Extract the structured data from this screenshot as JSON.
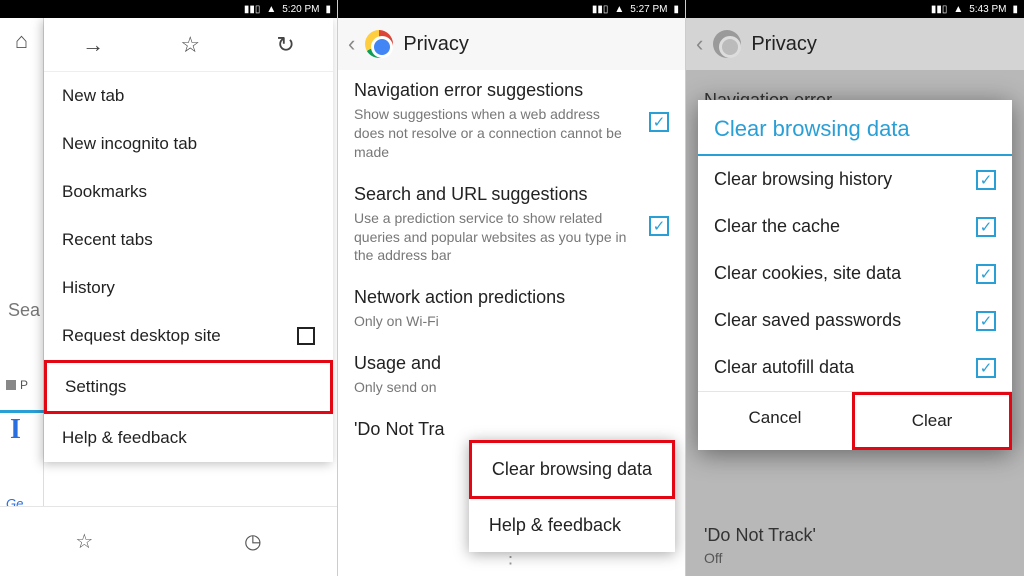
{
  "status": {
    "time1": "5:20 PM",
    "time2": "5:27 PM",
    "time3": "5:43 PM"
  },
  "panel1": {
    "search_partial": "Sea",
    "tab_label_partial": "P",
    "big_letter": "I",
    "get_partial": "Ge",
    "menu": {
      "new_tab": "New tab",
      "new_incognito": "New incognito tab",
      "bookmarks": "Bookmarks",
      "recent_tabs": "Recent tabs",
      "history": "History",
      "request_desktop": "Request desktop site",
      "settings": "Settings",
      "help_feedback": "Help & feedback"
    }
  },
  "panel2": {
    "title": "Privacy",
    "nav_err_title": "Navigation error suggestions",
    "nav_err_sub": "Show suggestions when a web address does not resolve or a connection cannot be made",
    "search_url_title": "Search and URL suggestions",
    "search_url_sub": "Use a prediction service to show related queries and popular websites as you type in the address bar",
    "net_pred_title": "Network action predictions",
    "net_pred_sub": "Only on Wi-Fi",
    "usage_title_partial": "Usage and",
    "usage_sub_partial": "Only send on",
    "dnt_partial": "'Do Not Tra",
    "popup": {
      "clear_browsing": "Clear browsing data",
      "help_feedback": "Help & feedback"
    }
  },
  "panel3": {
    "title": "Privacy",
    "bg_nav": "Navigation error",
    "bg_dnt": "'Do Not Track'",
    "bg_off": "Off",
    "dialog": {
      "title": "Clear browsing data",
      "opts": {
        "history": "Clear browsing history",
        "cache": "Clear the cache",
        "cookies": "Clear cookies, site data",
        "passwords": "Clear saved passwords",
        "autofill": "Clear autofill data"
      },
      "cancel": "Cancel",
      "clear": "Clear"
    }
  }
}
